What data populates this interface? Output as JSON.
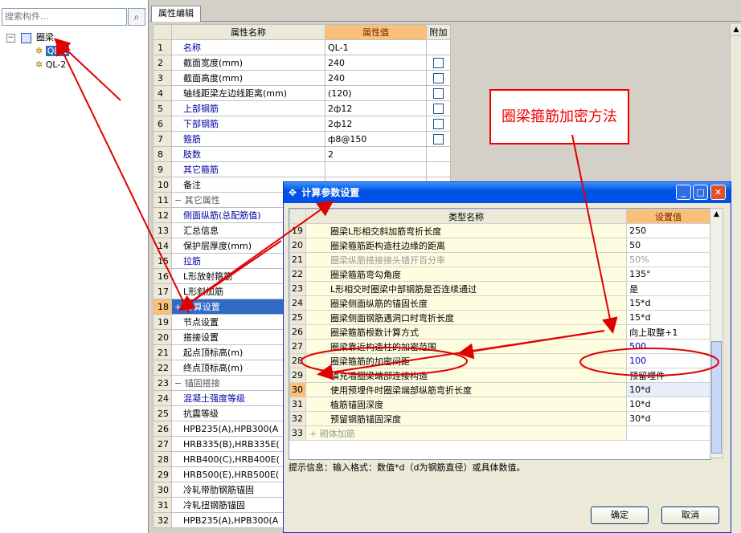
{
  "left_panel": {
    "search_placeholder": "搜索构件...",
    "search_icon": "magnifier-icon",
    "tree": {
      "expand_toggle": "−",
      "root": "圈梁",
      "children": [
        "QL-1",
        "QL-2"
      ]
    }
  },
  "tab": {
    "label": "属性编辑"
  },
  "prop_grid": {
    "headers": [
      "属性名称",
      "属性值",
      "附加"
    ],
    "rows": [
      {
        "n": "1",
        "name": "名称",
        "value": "QL-1",
        "style": "blue",
        "check": false
      },
      {
        "n": "2",
        "name": "截面宽度(mm)",
        "value": "240",
        "style": "",
        "check": true
      },
      {
        "n": "3",
        "name": "截面高度(mm)",
        "value": "240",
        "style": "",
        "check": true
      },
      {
        "n": "4",
        "name": "轴线距梁左边线距离(mm)",
        "value": "(120)",
        "style": "",
        "check": true
      },
      {
        "n": "5",
        "name": "上部钢筋",
        "value": "2ф12",
        "style": "blue",
        "check": true
      },
      {
        "n": "6",
        "name": "下部钢筋",
        "value": "2ф12",
        "style": "blue",
        "check": true
      },
      {
        "n": "7",
        "name": "箍筋",
        "value": "ф8@150",
        "style": "blue",
        "check": true
      },
      {
        "n": "8",
        "name": "肢数",
        "value": "2",
        "style": "blue",
        "check": false
      },
      {
        "n": "9",
        "name": "其它箍筋",
        "value": "",
        "style": "blue",
        "check": false
      },
      {
        "n": "10",
        "name": "备注",
        "value": "",
        "style": "",
        "check": false
      },
      {
        "n": "11",
        "name": "− 其它属性",
        "value": "",
        "style": "gray",
        "check": false
      },
      {
        "n": "12",
        "name": "侧面纵筋(总配筋值)",
        "value": "",
        "style": "blue",
        "check": false
      },
      {
        "n": "13",
        "name": "汇总信息",
        "value": "",
        "style": "",
        "check": false
      },
      {
        "n": "14",
        "name": "保护层厚度(mm)",
        "value": "",
        "style": "",
        "check": false
      },
      {
        "n": "15",
        "name": "拉筋",
        "value": "",
        "style": "blue",
        "check": false
      },
      {
        "n": "16",
        "name": "L形放射箍筋",
        "value": "",
        "style": "",
        "check": false
      },
      {
        "n": "17",
        "name": "L形斜加筋",
        "value": "",
        "style": "",
        "check": false
      },
      {
        "n": "18",
        "name": "+ 计算设置",
        "value": "",
        "style": "",
        "check": false,
        "selected": true
      },
      {
        "n": "19",
        "name": "节点设置",
        "value": "",
        "style": "",
        "check": false
      },
      {
        "n": "20",
        "name": "搭接设置",
        "value": "",
        "style": "",
        "check": false
      },
      {
        "n": "21",
        "name": "起点顶标高(m)",
        "value": "",
        "style": "",
        "check": false
      },
      {
        "n": "22",
        "name": "终点顶标高(m)",
        "value": "",
        "style": "",
        "check": false
      },
      {
        "n": "23",
        "name": "− 锚固搭接",
        "value": "",
        "style": "gray",
        "check": false
      },
      {
        "n": "24",
        "name": "混凝土强度等级",
        "value": "",
        "style": "blue",
        "check": false
      },
      {
        "n": "25",
        "name": "抗震等级",
        "value": "",
        "style": "",
        "check": false
      },
      {
        "n": "26",
        "name": "HPB235(A),HPB300(A",
        "value": "",
        "style": "",
        "check": false
      },
      {
        "n": "27",
        "name": "HRB335(B),HRB335E(",
        "value": "",
        "style": "",
        "check": false
      },
      {
        "n": "28",
        "name": "HRB400(C),HRB400E(",
        "value": "",
        "style": "",
        "check": false
      },
      {
        "n": "29",
        "name": "HRB500(E),HRB500E(",
        "value": "",
        "style": "",
        "check": false
      },
      {
        "n": "30",
        "name": "冷轧带肋钢筋锚固",
        "value": "",
        "style": "",
        "check": false
      },
      {
        "n": "31",
        "name": "冷轧扭钢筋锚固",
        "value": "",
        "style": "",
        "check": false
      },
      {
        "n": "32",
        "name": "HPB235(A),HPB300(A",
        "value": "",
        "style": "",
        "check": false
      }
    ]
  },
  "dialog": {
    "title": "计算参数设置",
    "headers": [
      "类型名称",
      "设置值"
    ],
    "rows": [
      {
        "n": "19",
        "name": "圈梁L形相交斜加筋弯折长度",
        "value": "250"
      },
      {
        "n": "20",
        "name": "圈梁箍筋距构造柱边缘的距离",
        "value": "50"
      },
      {
        "n": "21",
        "name": "圈梁纵筋搭接接头错开百分率",
        "value": "50%",
        "dim": true
      },
      {
        "n": "22",
        "name": "圈梁箍筋弯勾角度",
        "value": "135°"
      },
      {
        "n": "23",
        "name": "L形相交时圈梁中部钢筋是否连续通过",
        "value": "是"
      },
      {
        "n": "24",
        "name": "圈梁侧面纵筋的锚固长度",
        "value": "15*d"
      },
      {
        "n": "25",
        "name": "圈梁侧面钢筋遇洞口时弯折长度",
        "value": "15*d"
      },
      {
        "n": "26",
        "name": "圈梁箍筋根数计算方式",
        "value": "向上取整+1"
      },
      {
        "n": "27",
        "name": "圈梁靠近构造柱的加密范围",
        "value": "500",
        "blue": true
      },
      {
        "n": "28",
        "name": "圈梁箍筋的加密间距",
        "value": "100",
        "blue": true
      },
      {
        "n": "29",
        "name": "填充墙圈梁端部连接构造",
        "value": "预留埋件"
      },
      {
        "n": "30",
        "name": "使用预埋件时圈梁端部纵筋弯折长度",
        "value": "10*d",
        "selected": true
      },
      {
        "n": "31",
        "name": "植筋锚固深度",
        "value": "10*d"
      },
      {
        "n": "32",
        "name": "预留钢筋锚固深度",
        "value": "30*d"
      },
      {
        "n": "33",
        "name": "+ 砌体加筋",
        "value": "",
        "dim": true
      }
    ],
    "tip": "提示信息：输入格式：数值*d（d为钢筋直径）或具体数值。",
    "ok": "确定",
    "cancel": "取消",
    "min_glyph": "_",
    "max_glyph": "□",
    "close_glyph": "✕"
  },
  "annotation": {
    "text": "圈梁箍筋加密方法",
    "color": "#e00000"
  }
}
